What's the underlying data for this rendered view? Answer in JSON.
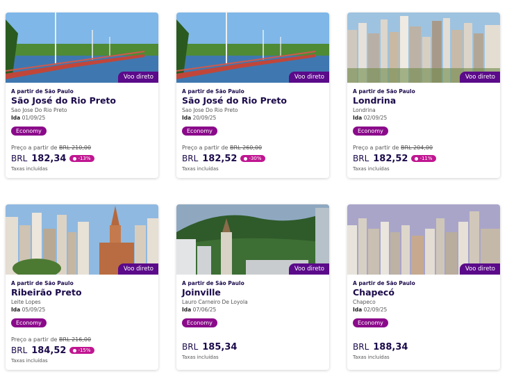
{
  "cards": [
    {
      "origin": "A partir de São Paulo",
      "city": "São José do Rio Preto",
      "airport": "Sao Jose Do Rio Preto",
      "date_label": "Ida",
      "date": "01/09/25",
      "badge": "Voo direto",
      "fare": "Economy",
      "from_label": "Preço a partir de",
      "old_price": "BRL 210,00",
      "currency": "BRL",
      "price": "182,34",
      "discount": "-13%",
      "tax": "Taxas incluídas"
    },
    {
      "origin": "A partir de São Paulo",
      "city": "São José do Rio Preto",
      "airport": "Sao Jose Do Rio Preto",
      "date_label": "Ida",
      "date": "20/09/25",
      "badge": "Voo direto",
      "fare": "Economy",
      "from_label": "Preço a partir de",
      "old_price": "BRL 260,00",
      "currency": "BRL",
      "price": "182,52",
      "discount": "-30%",
      "tax": "Taxas incluídas"
    },
    {
      "origin": "A partir de São Paulo",
      "city": "Londrina",
      "airport": "Londrina",
      "date_label": "Ida",
      "date": "02/09/25",
      "badge": "Voo direto",
      "fare": "Economy",
      "from_label": "Preço a partir de",
      "old_price": "BRL 204,00",
      "currency": "BRL",
      "price": "182,52",
      "discount": "-11%",
      "tax": "Taxas incluídas"
    },
    {
      "origin": "A partir de São Paulo",
      "city": "Ribeirão Preto",
      "airport": "Leite Lopes",
      "date_label": "Ida",
      "date": "05/09/25",
      "badge": "Voo direto",
      "fare": "Economy",
      "from_label": "Preço a partir de",
      "old_price": "BRL 216,00",
      "currency": "BRL",
      "price": "184,52",
      "discount": "-15%",
      "tax": "Taxas incluídas"
    },
    {
      "origin": "A partir de São Paulo",
      "city": "Joinville",
      "airport": "Lauro Carneiro De Loyola",
      "date_label": "Ida",
      "date": "07/06/25",
      "badge": "Voo direto",
      "fare": "Economy",
      "currency": "BRL",
      "price": "185,34",
      "tax": "Taxas incluídas"
    },
    {
      "origin": "A partir de São Paulo",
      "city": "Chapecó",
      "airport": "Chapeco",
      "date_label": "Ida",
      "date": "02/09/25",
      "badge": "Voo direto",
      "fare": "Economy",
      "currency": "BRL",
      "price": "188,34",
      "tax": "Taxas incluídas"
    }
  ]
}
